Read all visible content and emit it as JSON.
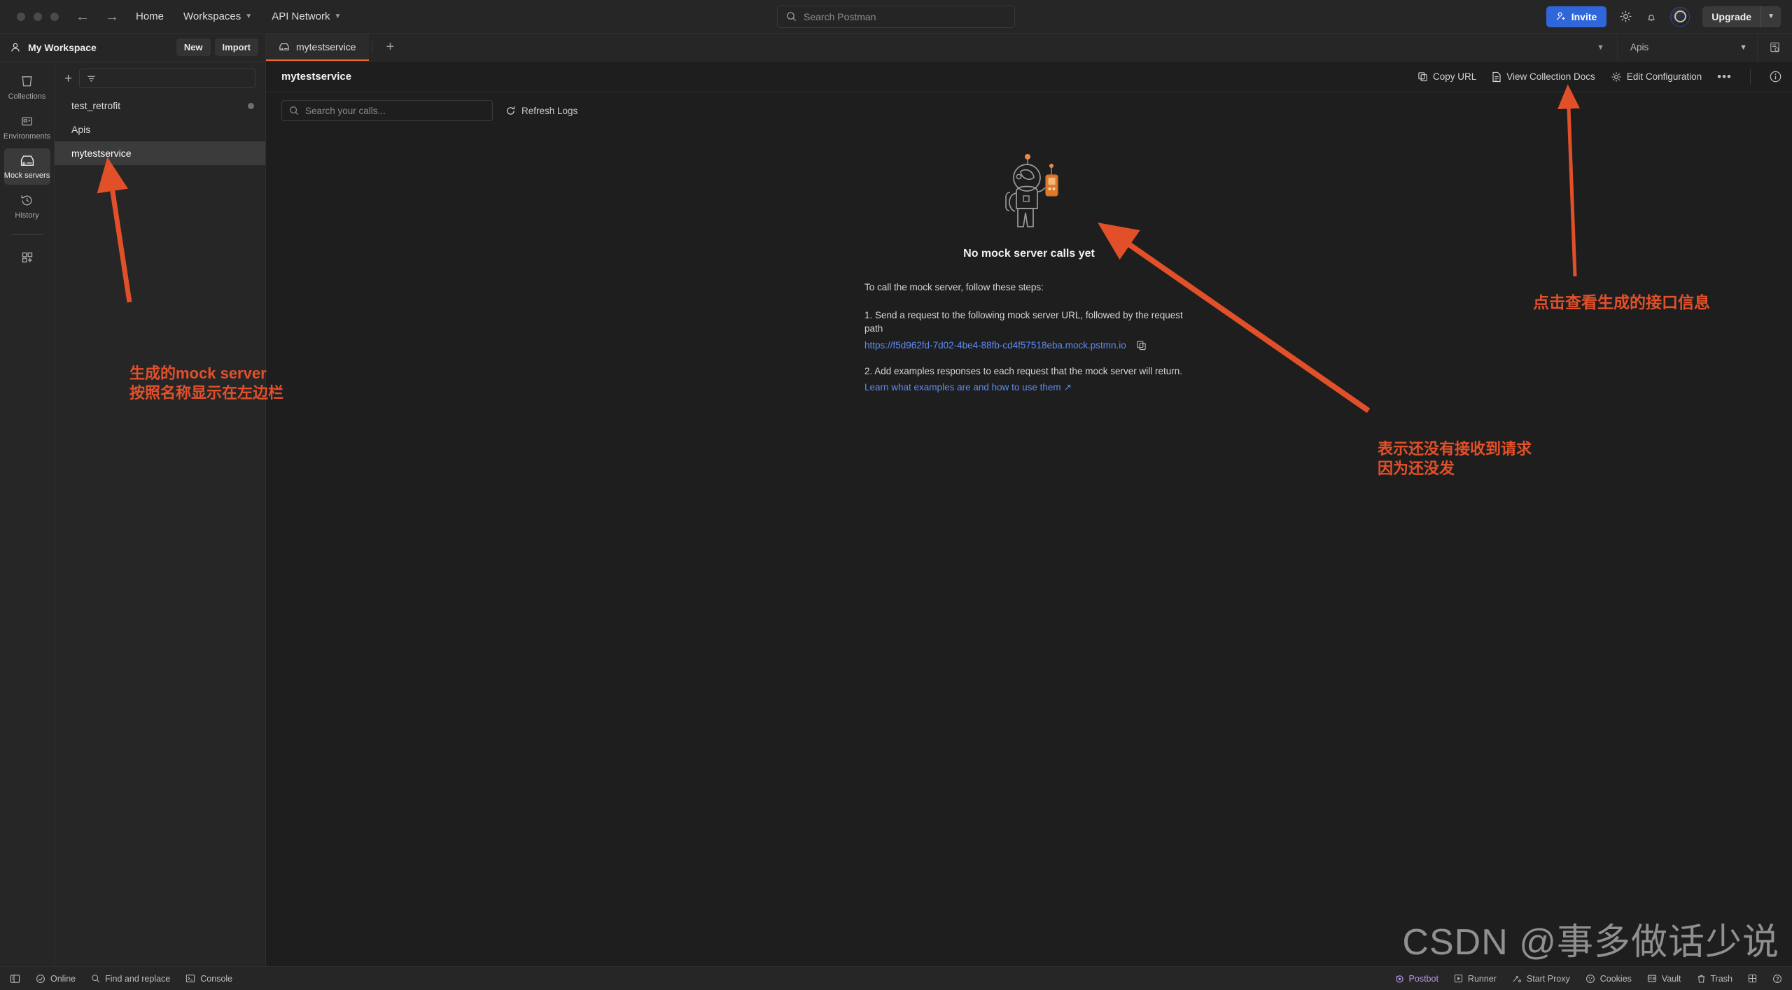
{
  "topbar": {
    "nav_back": "back-arrow",
    "nav_forward": "forward-arrow",
    "home": "Home",
    "workspaces": "Workspaces",
    "api_network": "API Network",
    "search_placeholder": "Search Postman",
    "invite": "Invite",
    "upgrade": "Upgrade",
    "accent_blue": "#2f66d9"
  },
  "workspace": {
    "name": "My Workspace",
    "new_label": "New",
    "import_label": "Import"
  },
  "tabs": {
    "items": [
      {
        "label": "mytestservice",
        "icon": "mock-server-icon",
        "active": true
      }
    ],
    "add_label": "+",
    "environment_selected": "Apis"
  },
  "rail": {
    "items": [
      {
        "label": "Collections",
        "icon": "collections-icon",
        "active": false
      },
      {
        "label": "Environments",
        "icon": "environments-icon",
        "active": false
      },
      {
        "label": "Mock servers",
        "icon": "mock-servers-icon",
        "active": true
      },
      {
        "label": "History",
        "icon": "history-icon",
        "active": false
      }
    ],
    "more_icon": "add-module-icon"
  },
  "list_pane": {
    "add_icon": "plus-icon",
    "filter_icon": "filter-icon",
    "items": [
      {
        "label": "test_retrofit",
        "has_dot": true,
        "active": false
      },
      {
        "label": "Apis",
        "has_dot": false,
        "active": false
      },
      {
        "label": "mytestservice",
        "has_dot": false,
        "active": true
      }
    ]
  },
  "main": {
    "title": "mytestservice",
    "actions": [
      {
        "label": "Copy URL",
        "icon": "copy-icon"
      },
      {
        "label": "View Collection Docs",
        "icon": "document-icon"
      },
      {
        "label": "Edit Configuration",
        "icon": "gear-icon"
      }
    ],
    "more_label": "•••",
    "info_icon": "info-icon",
    "calls_search_placeholder": "Search your calls...",
    "refresh_label": "Refresh Logs",
    "empty_title": "No mock server calls yet",
    "steps_intro": "To call the mock server, follow these steps:",
    "step1": "1. Send a request to the following mock server URL, followed by the request path",
    "mock_url": "https://f5d962fd-7d02-4be4-88fb-cd4f57518eba.mock.pstmn.io",
    "step2": "2. Add examples responses to each request that the mock server will return.",
    "learn_link": "Learn what examples are and how to use them",
    "link_color": "#5d8bf4"
  },
  "statusbar": {
    "left": [
      {
        "label": "",
        "icon": "sidebar-toggle-icon"
      },
      {
        "label": "Online",
        "icon": "online-icon"
      },
      {
        "label": "Find and replace",
        "icon": "search-icon"
      },
      {
        "label": "Console",
        "icon": "console-icon"
      }
    ],
    "right": [
      {
        "label": "Postbot",
        "icon": "postbot-icon"
      },
      {
        "label": "Runner",
        "icon": "runner-icon"
      },
      {
        "label": "Start Proxy",
        "icon": "proxy-icon"
      },
      {
        "label": "Cookies",
        "icon": "cookies-icon"
      },
      {
        "label": "Vault",
        "icon": "vault-icon"
      },
      {
        "label": "Trash",
        "icon": "trash-icon"
      },
      {
        "label": "",
        "icon": "layout-icon"
      },
      {
        "label": "",
        "icon": "help-icon"
      }
    ]
  },
  "annotations": {
    "color": "#e2502a",
    "left": "生成的mock server\n按照名称显示在左边栏",
    "right_top": "点击查看生成的接口信息",
    "right_bottom": "表示还没有接收到请求\n因为还没发"
  },
  "watermark": "CSDN @事多做话少说"
}
